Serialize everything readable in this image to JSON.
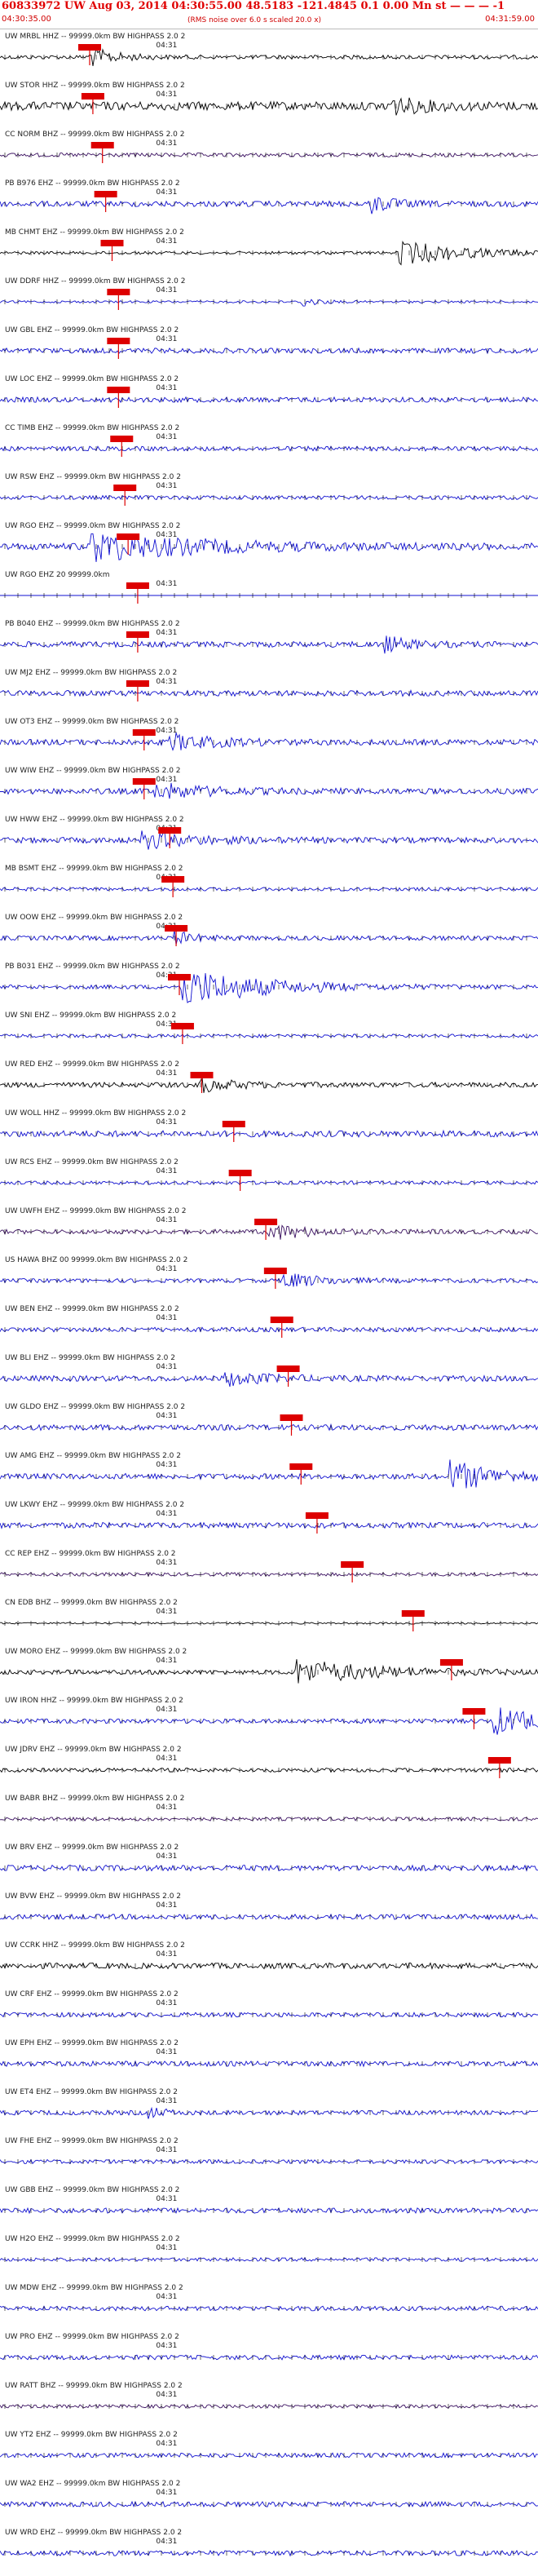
{
  "header": {
    "title": "60833972 UW Aug 03, 2014 04:30:55.00   48.5183 -121.4845  0.1 0.00 Mn st — — —  -1",
    "start_time": "04:30:35.00",
    "end_time": "04:31:59.00",
    "noise": "(RMS noise over 6.0 s scaled 20.0 x)"
  },
  "colors": {
    "trace_blue": "#1010d0",
    "trace_black": "#000000",
    "trace_purple": "#3a1060",
    "pick_red": "#dd0000",
    "label": "#222222"
  },
  "chart_data": {
    "type": "line",
    "title": "60833972 UW Aug 03, 2014 04:30:55.00   48.5183 -121.4845  0.1 0.00 Mn st — — —  -1",
    "time_start": "04:30:35.00",
    "time_end": "04:31:59.00",
    "tick_label": "04:31",
    "tick_label_time_s": 25,
    "duration_s": 84,
    "grid": false,
    "legend": "none",
    "series": [
      {
        "label": "UW MRBL HHZ -- 99999.0km BW  HIGHPASS  2.0  2",
        "color": "black",
        "noise": 0.35,
        "pick_s": 14,
        "burst_s": 14,
        "burst_amp": 1.6,
        "burst_dur": 4
      },
      {
        "label": "UW STOR HHZ -- 99999.0km BW  HIGHPASS  2.0  2",
        "color": "black",
        "noise": 0.75,
        "pick_s": 14.5,
        "burst_s": 60,
        "burst_amp": 1.6,
        "burst_dur": 5
      },
      {
        "label": "CC NORM BHZ -- 99999.0km BW  HIGHPASS  2.0  2",
        "color": "purple",
        "noise": 0.35,
        "pick_s": 16
      },
      {
        "label": "PB B976 EHZ -- 99999.0km BW  HIGHPASS  2.0  2",
        "color": "blue",
        "noise": 0.5,
        "pick_s": 16.5,
        "burst_s": 58,
        "burst_amp": 1.6,
        "burst_dur": 3
      },
      {
        "label": "MB CHMT EHZ -- 99999.0km BW  HIGHPASS  2.0  2",
        "color": "black",
        "noise": 0.25,
        "pick_s": 17.5,
        "burst_s": 62,
        "burst_amp": 2.2,
        "burst_dur": 10
      },
      {
        "label": "UW DDRF HHZ -- 99999.0km BW  HIGHPASS  2.0  2",
        "color": "blue",
        "noise": 0.2,
        "pick_s": 18.5,
        "burst_s": 47,
        "burst_amp": 1.2,
        "burst_dur": 2
      },
      {
        "label": "UW GBL EHZ -- 99999.0km BW  HIGHPASS  2.0  2",
        "color": "blue",
        "noise": 0.45,
        "pick_s": 18.5
      },
      {
        "label": "UW LOC EHZ -- 99999.0km BW  HIGHPASS  2.0  2",
        "color": "blue",
        "noise": 0.45,
        "pick_s": 18.5
      },
      {
        "label": "CC TIMB EHZ -- 99999.0km BW  HIGHPASS  2.0  2",
        "color": "blue",
        "noise": 0.4,
        "pick_s": 19
      },
      {
        "label": "UW RSW EHZ -- 99999.0km BW  HIGHPASS  2.0  2",
        "color": "blue",
        "noise": 0.35,
        "pick_s": 19.5
      },
      {
        "label": "UW RGO EHZ -- 99999.0km BW  HIGHPASS  2.0  2",
        "color": "blue",
        "noise": 0.6,
        "pick_s": 20,
        "burst_s": 14,
        "burst_amp": 2.5,
        "burst_dur": 16
      },
      {
        "label": "UW RGO EHZ 20 99999.0km",
        "color": "blue",
        "noise": 0.0,
        "pick_s": 21.5
      },
      {
        "label": "PB B040 EHZ -- 99999.0km BW  HIGHPASS  2.0  2",
        "color": "blue",
        "noise": 0.5,
        "pick_s": 21.5,
        "burst_s": 60,
        "burst_amp": 1.3,
        "burst_dur": 4
      },
      {
        "label": "UW MJ2 EHZ -- 99999.0km BW  HIGHPASS  2.0  2",
        "color": "blue",
        "noise": 0.5,
        "pick_s": 21.5
      },
      {
        "label": "UW OT3 EHZ -- 99999.0km BW  HIGHPASS  2.0  2",
        "color": "blue",
        "noise": 0.5,
        "pick_s": 22.5,
        "burst_s": 26,
        "burst_amp": 1.5,
        "burst_dur": 7
      },
      {
        "label": "UW WIW EHZ -- 99999.0km BW  HIGHPASS  2.0  2",
        "color": "blue",
        "noise": 0.5,
        "pick_s": 22.5,
        "burst_s": 24,
        "burst_amp": 1.4,
        "burst_dur": 8
      },
      {
        "label": "UW HWW EHZ -- 99999.0km BW  HIGHPASS  2.0  2",
        "color": "blue",
        "noise": 0.5,
        "pick_s": 26.5,
        "burst_s": 22,
        "burst_amp": 1.4,
        "burst_dur": 8
      },
      {
        "label": "MB BSMT EHZ -- 99999.0km BW  HIGHPASS  2.0  2",
        "color": "blue",
        "noise": 0.3,
        "pick_s": 27
      },
      {
        "label": "UW OOW EHZ -- 99999.0km BW  HIGHPASS  2.0  2",
        "color": "blue",
        "noise": 0.4,
        "pick_s": 27.5,
        "burst_s": 27,
        "burst_amp": 1.2,
        "burst_dur": 3
      },
      {
        "label": "PB B031 EHZ -- 99999.0km BW  HIGHPASS  2.0  2",
        "color": "blue",
        "noise": 0.35,
        "pick_s": 28,
        "burst_s": 28,
        "burst_amp": 3.5,
        "burst_dur": 12
      },
      {
        "label": "UW SNI EHZ -- 99999.0km BW  HIGHPASS  2.0  2",
        "color": "blue",
        "noise": 0.3,
        "pick_s": 28.5
      },
      {
        "label": "UW RED EHZ -- 99999.0km BW  HIGHPASS  2.0  2",
        "color": "black",
        "noise": 0.45,
        "pick_s": 31.5,
        "burst_s": 31,
        "burst_amp": 1.2,
        "burst_dur": 5
      },
      {
        "label": "UW WOLL HHZ -- 99999.0km BW  HIGHPASS  2.0  2",
        "color": "blue",
        "noise": 0.55,
        "pick_s": 36.5
      },
      {
        "label": "UW RCS EHZ -- 99999.0km BW  HIGHPASS  2.0  2",
        "color": "blue",
        "noise": 0.3,
        "pick_s": 37.5
      },
      {
        "label": "UW UWFH EHZ -- 99999.0km BW  HIGHPASS  2.0  2",
        "color": "purple",
        "noise": 0.4,
        "pick_s": 41.5,
        "burst_s": 42,
        "burst_amp": 1.4,
        "burst_dur": 6
      },
      {
        "label": "US HAWA BHZ 00 99999.0km BW  HIGHPASS  2.0  2",
        "color": "blue",
        "noise": 0.35,
        "pick_s": 43,
        "burst_s": 44,
        "burst_amp": 1.4,
        "burst_dur": 6
      },
      {
        "label": "UW BEN EHZ -- 99999.0km BW  HIGHPASS  2.0  2",
        "color": "blue",
        "noise": 0.4,
        "pick_s": 44
      },
      {
        "label": "UW BLI EHZ -- 99999.0km BW  HIGHPASS  2.0  2",
        "color": "blue",
        "noise": 0.5,
        "pick_s": 45,
        "burst_s": 35,
        "burst_amp": 1.2,
        "burst_dur": 6
      },
      {
        "label": "UW GLDO EHZ -- 99999.0km BW  HIGHPASS  2.0  2",
        "color": "blue",
        "noise": 0.5,
        "pick_s": 45.5
      },
      {
        "label": "UW AMG EHZ -- 99999.0km BW  HIGHPASS  2.0  2",
        "color": "blue",
        "noise": 0.5,
        "pick_s": 47,
        "burst_s": 70,
        "burst_amp": 2.8,
        "burst_dur": 7
      },
      {
        "label": "UW LKWY EHZ -- 99999.0km BW  HIGHPASS  2.0  2",
        "color": "blue",
        "noise": 0.5,
        "pick_s": 49.5
      },
      {
        "label": "CC REP EHZ -- 99999.0km BW  HIGHPASS  2.0  2",
        "color": "purple",
        "noise": 0.3,
        "pick_s": 55
      },
      {
        "label": "CN EDB BHZ -- 99999.0km BW  HIGHPASS  2.0  2",
        "color": "black",
        "noise": 0.15,
        "pick_s": 64.5
      },
      {
        "label": "UW MORO EHZ -- 99999.0km BW  HIGHPASS  2.0  2",
        "color": "black",
        "noise": 0.4,
        "pick_s": 70.5,
        "burst_s": 46,
        "burst_amp": 2.2,
        "burst_dur": 12
      },
      {
        "label": "UW IRON HHZ -- 99999.0km BW  HIGHPASS  2.0  2",
        "color": "blue",
        "noise": 0.4,
        "pick_s": 74,
        "burst_s": 77,
        "burst_amp": 2.4,
        "burst_dur": 8
      },
      {
        "label": "UW JDRV EHZ -- 99999.0km BW  HIGHPASS  2.0  2",
        "color": "black",
        "noise": 0.35,
        "pick_s": 78
      },
      {
        "label": "UW BABR BHZ -- 99999.0km BW  HIGHPASS  2.0  2",
        "color": "purple",
        "noise": 0.3
      },
      {
        "label": "UW BRV EHZ -- 99999.0km BW  HIGHPASS  2.0  2",
        "color": "blue",
        "noise": 0.5
      },
      {
        "label": "UW BVW EHZ -- 99999.0km BW  HIGHPASS  2.0  2",
        "color": "blue",
        "noise": 0.45
      },
      {
        "label": "UW CCRK HHZ -- 99999.0km BW  HIGHPASS  2.0  2",
        "color": "black",
        "noise": 0.5
      },
      {
        "label": "UW CRF EHZ -- 99999.0km BW  HIGHPASS  2.0  2",
        "color": "blue",
        "noise": 0.4
      },
      {
        "label": "UW EPH EHZ -- 99999.0km BW  HIGHPASS  2.0  2",
        "color": "blue",
        "noise": 0.45
      },
      {
        "label": "UW ET4 EHZ -- 99999.0km BW  HIGHPASS  2.0  2",
        "color": "blue",
        "noise": 0.4,
        "burst_s": 23,
        "burst_amp": 1.1,
        "burst_dur": 2
      },
      {
        "label": "UW FHE EHZ -- 99999.0km BW  HIGHPASS  2.0  2",
        "color": "blue",
        "noise": 0.35
      },
      {
        "label": "UW GBB EHZ -- 99999.0km BW  HIGHPASS  2.0  2",
        "color": "blue",
        "noise": 0.45
      },
      {
        "label": "UW H2O EHZ -- 99999.0km BW  HIGHPASS  2.0  2",
        "color": "blue",
        "noise": 0.3
      },
      {
        "label": "UW MDW EHZ -- 99999.0km BW  HIGHPASS  2.0  2",
        "color": "blue",
        "noise": 0.4
      },
      {
        "label": "UW PRO EHZ -- 99999.0km BW  HIGHPASS  2.0  2",
        "color": "blue",
        "noise": 0.4
      },
      {
        "label": "UW RATT BHZ -- 99999.0km BW  HIGHPASS  2.0  2",
        "color": "purple",
        "noise": 0.3
      },
      {
        "label": "UW YT2 EHZ -- 99999.0km BW  HIGHPASS  2.0  2",
        "color": "blue",
        "noise": 0.4
      },
      {
        "label": "UW WA2 EHZ -- 99999.0km BW  HIGHPASS  2.0  2",
        "color": "blue",
        "noise": 0.45
      },
      {
        "label": "UW WRD EHZ -- 99999.0km BW  HIGHPASS  2.0  2",
        "color": "blue",
        "noise": 0.45
      }
    ]
  }
}
